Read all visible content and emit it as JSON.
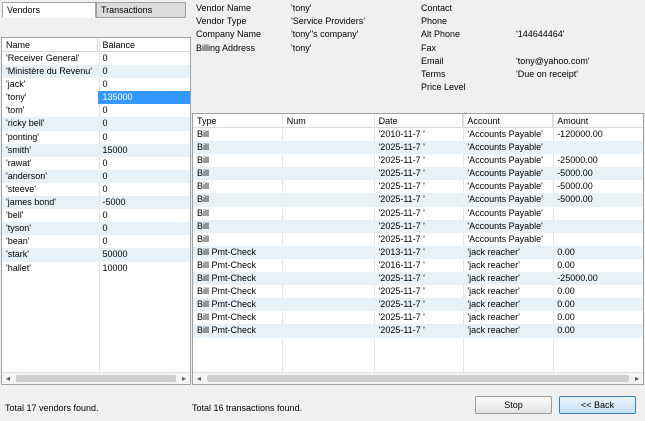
{
  "tabs": {
    "vendors": "Vendors",
    "transactions": "Transactions"
  },
  "vendor_list": {
    "columns": [
      "Name",
      "Balance"
    ],
    "rows": [
      {
        "name": "'Receiver General'",
        "balance": "0"
      },
      {
        "name": "'Ministère du Revenu'",
        "balance": "0"
      },
      {
        "name": "'jack'",
        "balance": "0"
      },
      {
        "name": "'tony'",
        "balance": "135000"
      },
      {
        "name": "'tom'",
        "balance": "0"
      },
      {
        "name": "'ricky bell'",
        "balance": "0"
      },
      {
        "name": "'ponting'",
        "balance": "0"
      },
      {
        "name": "'smith'",
        "balance": "15000"
      },
      {
        "name": "'rawat'",
        "balance": "0"
      },
      {
        "name": "'anderson'",
        "balance": "0"
      },
      {
        "name": "'steeve'",
        "balance": "0"
      },
      {
        "name": "'james bond'",
        "balance": "-5000"
      },
      {
        "name": "'bell'",
        "balance": "0"
      },
      {
        "name": "'tyson'",
        "balance": "0"
      },
      {
        "name": "'bean'",
        "balance": "0"
      },
      {
        "name": "'stark'",
        "balance": "50000"
      },
      {
        "name": "'hallet'",
        "balance": "10000"
      }
    ],
    "selected_index": 3
  },
  "vendor_info": {
    "left": [
      {
        "label": "Vendor Name",
        "value": "'tony'"
      },
      {
        "label": "Vendor Type",
        "value": "'Service Providers'"
      },
      {
        "label": "Company Name",
        "value": "'tony''s company'"
      },
      {
        "label": "Billing Address",
        "value": "'tony'"
      }
    ],
    "right": [
      {
        "label": "Contact",
        "value": ""
      },
      {
        "label": "Phone",
        "value": ""
      },
      {
        "label": "Alt Phone",
        "value": "'144644464'"
      },
      {
        "label": "Fax",
        "value": ""
      },
      {
        "label": "Email",
        "value": "'tony@yahoo.com'"
      },
      {
        "label": "Terms",
        "value": "'Due on receipt'"
      },
      {
        "label": "Price Level",
        "value": ""
      }
    ]
  },
  "transactions": {
    "columns": [
      "Type",
      "Num",
      "Date",
      "Account",
      "Amount"
    ],
    "rows": [
      {
        "type": "Bill",
        "num": "",
        "date": "'2010-11-7 '",
        "account": "'Accounts Payable'",
        "amount": "-120000.00"
      },
      {
        "type": "Bill",
        "num": "",
        "date": "'2025-11-7 '",
        "account": "'Accounts Payable'",
        "amount": ""
      },
      {
        "type": "Bill",
        "num": "",
        "date": "'2025-11-7 '",
        "account": "'Accounts Payable'",
        "amount": "-25000.00"
      },
      {
        "type": "Bill",
        "num": "",
        "date": "'2025-11-7 '",
        "account": "'Accounts Payable'",
        "amount": "-5000.00"
      },
      {
        "type": "Bill",
        "num": "",
        "date": "'2025-11-7 '",
        "account": "'Accounts Payable'",
        "amount": "-5000.00"
      },
      {
        "type": "Bill",
        "num": "",
        "date": "'2025-11-7 '",
        "account": "'Accounts Payable'",
        "amount": "-5000.00"
      },
      {
        "type": "Bill",
        "num": "",
        "date": "'2025-11-7 '",
        "account": "'Accounts Payable'",
        "amount": ""
      },
      {
        "type": "Bill",
        "num": "",
        "date": "'2025-11-7 '",
        "account": "'Accounts Payable'",
        "amount": ""
      },
      {
        "type": "Bill",
        "num": "",
        "date": "'2025-11-7 '",
        "account": "'Accounts Payable'",
        "amount": ""
      },
      {
        "type": "Bill Pmt-Check",
        "num": "",
        "date": "'2013-11-7 '",
        "account": "'jack reacher'",
        "amount": "0.00"
      },
      {
        "type": "Bill Pmt-Check",
        "num": "",
        "date": "'2016-11-7 '",
        "account": "'jack reacher'",
        "amount": "0.00"
      },
      {
        "type": "Bill Pmt-Check",
        "num": "",
        "date": "'2025-11-7 '",
        "account": "'jack reacher'",
        "amount": "-25000.00"
      },
      {
        "type": "Bill Pmt-Check",
        "num": "",
        "date": "'2025-11-7 '",
        "account": "'jack reacher'",
        "amount": "0.00"
      },
      {
        "type": "Bill Pmt-Check",
        "num": "",
        "date": "'2025-11-7 '",
        "account": "'jack reacher'",
        "amount": "0.00"
      },
      {
        "type": "Bill Pmt-Check",
        "num": "",
        "date": "'2025-11-7 '",
        "account": "'jack reacher'",
        "amount": "0.00"
      },
      {
        "type": "Bill Pmt-Check",
        "num": "",
        "date": "'2025-11-7 '",
        "account": "'jack reacher'",
        "amount": "0.00"
      }
    ]
  },
  "status": {
    "vendors": "Total 17 vendors found.",
    "transactions": "Total 16 transactions found."
  },
  "buttons": {
    "stop": "Stop",
    "back": "<<  Back"
  },
  "colors": {
    "selected_row": "#3399ff",
    "alt_row": "#e8f0f8",
    "primary_button": "#c6e1f5"
  }
}
